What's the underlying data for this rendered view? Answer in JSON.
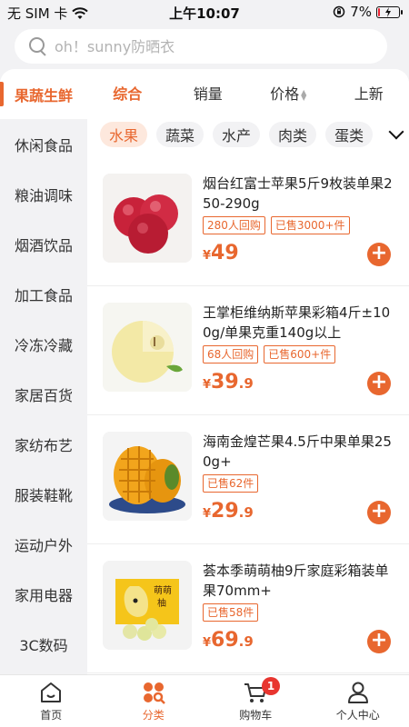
{
  "status_bar": {
    "carrier": "无 SIM 卡",
    "time": "上午10:07",
    "battery_percent": "7%",
    "battery_level": 0.07
  },
  "search": {
    "placeholder": "oh！sunny防晒衣"
  },
  "sidebar": {
    "items": [
      {
        "label": "果蔬生鲜",
        "active": true
      },
      {
        "label": "休闲食品"
      },
      {
        "label": "粮油调味"
      },
      {
        "label": "烟酒饮品"
      },
      {
        "label": "加工食品"
      },
      {
        "label": "冷冻冷藏"
      },
      {
        "label": "家居百货"
      },
      {
        "label": "家纺布艺"
      },
      {
        "label": "服装鞋靴"
      },
      {
        "label": "运动户外"
      },
      {
        "label": "家用电器"
      },
      {
        "label": "3C数码"
      }
    ]
  },
  "sort_tabs": {
    "items": [
      {
        "label": "综合",
        "active": true
      },
      {
        "label": "销量"
      },
      {
        "label": "价格"
      },
      {
        "label": "上新"
      }
    ]
  },
  "categories": {
    "items": [
      {
        "label": "水果",
        "active": true
      },
      {
        "label": "蔬菜"
      },
      {
        "label": "水产"
      },
      {
        "label": "肉类"
      },
      {
        "label": "蛋类"
      }
    ]
  },
  "products": [
    {
      "name": "烟台红富士苹果5斤9枚装单果250-290g",
      "tags": [
        "280人回购",
        "已售3000+件"
      ],
      "currency": "¥",
      "price_int": "49",
      "price_dec": ""
    },
    {
      "name": "王掌柜维纳斯苹果彩箱4斤±100g/单果克重140g以上",
      "tags": [
        "68人回购",
        "已售600+件"
      ],
      "currency": "¥",
      "price_int": "39",
      "price_dec": ".9"
    },
    {
      "name": "海南金煌芒果4.5斤中果单果250g+",
      "tags": [
        "已售62件"
      ],
      "currency": "¥",
      "price_int": "29",
      "price_dec": ".9"
    },
    {
      "name": "荟本季萌萌柚9斤家庭彩箱装单果70mm+",
      "tags": [
        "已售58件"
      ],
      "currency": "¥",
      "price_int": "69",
      "price_dec": ".9"
    }
  ],
  "add_symbol": "+",
  "tabbar": {
    "items": [
      {
        "label": "首页",
        "icon": "home-icon"
      },
      {
        "label": "分类",
        "icon": "category-icon",
        "active": true
      },
      {
        "label": "购物车",
        "icon": "cart-icon",
        "badge": "1"
      },
      {
        "label": "个人中心",
        "icon": "user-icon"
      }
    ]
  },
  "colors": {
    "accent": "#e8672f",
    "badge": "#e8352f"
  }
}
